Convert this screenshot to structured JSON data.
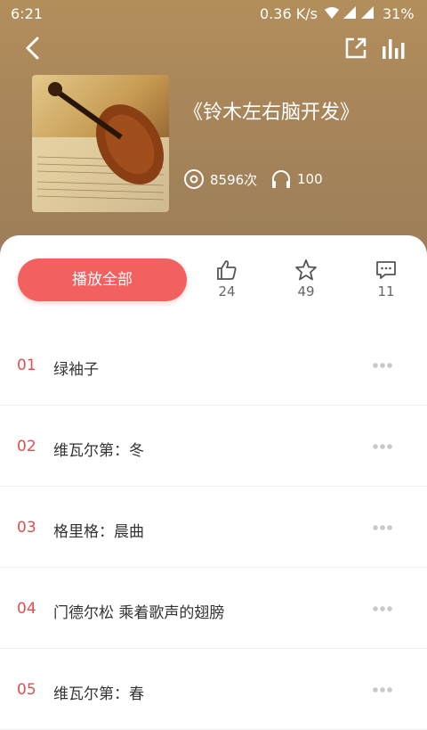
{
  "status_bar": {
    "time": "6:21",
    "network_speed": "0.36 K/s",
    "battery": "31%"
  },
  "album": {
    "title": "《铃木左右脑开发》",
    "play_count": "8596次",
    "listeners": "100"
  },
  "actions": {
    "play_all_label": "播放全部",
    "likes": "24",
    "favorites": "49",
    "comments": "11"
  },
  "tracks": [
    {
      "index": "01",
      "name": "绿袖子"
    },
    {
      "index": "02",
      "name": "维瓦尔第：冬"
    },
    {
      "index": "03",
      "name": "格里格：晨曲"
    },
    {
      "index": "04",
      "name": "门德尔松 乘着歌声的翅膀"
    },
    {
      "index": "05",
      "name": "维瓦尔第：春"
    }
  ],
  "colors": {
    "accent": "#f26160",
    "track_index": "#e0504f",
    "header_bg": "#a8865a"
  },
  "icons": [
    "back-arrow-icon",
    "share-icon",
    "equalizer-icon",
    "disc-icon",
    "headphones-icon",
    "thumbs-up-icon",
    "star-icon",
    "comment-icon",
    "more-dots-icon"
  ]
}
